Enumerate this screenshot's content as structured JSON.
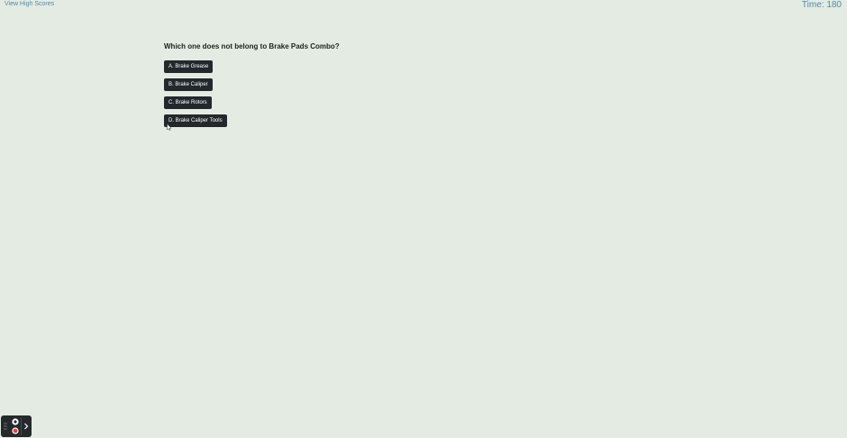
{
  "header": {
    "high_scores_label": "View High Scores",
    "timer_text": "Time: 180"
  },
  "quiz": {
    "question": "Which one does not belong to Brake Pads Combo?",
    "choices": [
      {
        "label": "A. Brake Grease"
      },
      {
        "label": "B. Brake Caliper"
      },
      {
        "label": "C. Brake Rotors"
      },
      {
        "label": "D. Brake Caliper Tools"
      }
    ]
  },
  "recorder_widget": {
    "icons": [
      "drag-handle-icon",
      "camera-icon",
      "record-icon",
      "chevron-right-icon"
    ]
  },
  "colors": {
    "background": "#e4ebe3",
    "button_bg": "#23282c",
    "link": "#4f8aa8",
    "record_red": "#e0443c"
  }
}
